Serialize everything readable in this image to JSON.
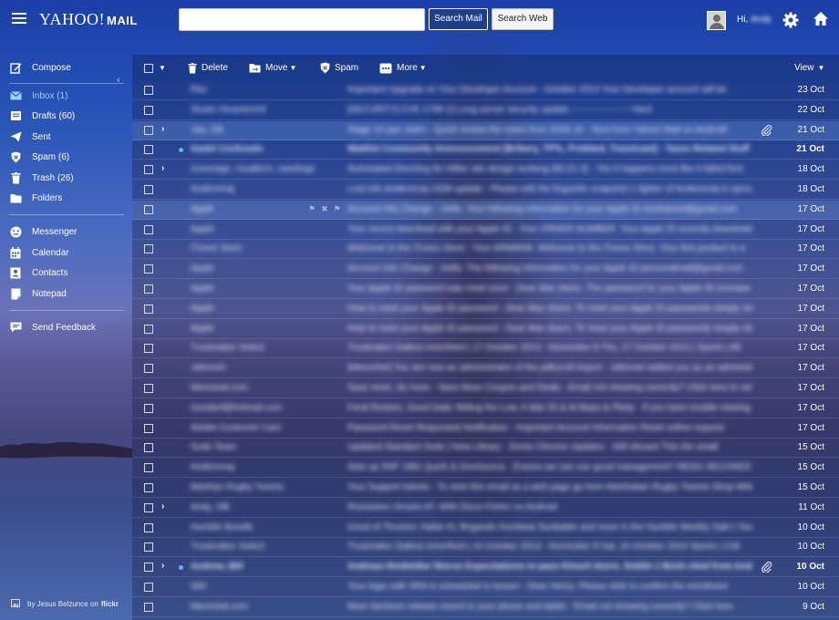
{
  "header": {
    "logo_yahoo": "YAHOO!",
    "logo_mail": "MAIL",
    "search_value": "",
    "search_mail_label": "Search Mail",
    "search_web_label": "Search Web",
    "greeting": "Hi,",
    "user_name": "Andy"
  },
  "sidebar": {
    "compose": "Compose",
    "folders": [
      {
        "label": "Inbox (1)",
        "icon": "envelope-icon",
        "active": true
      },
      {
        "label": "Drafts (60)",
        "icon": "drafts-icon"
      },
      {
        "label": "Sent",
        "icon": "paper-plane-icon"
      },
      {
        "label": "Spam (6)",
        "icon": "shield-icon"
      },
      {
        "label": "Trash (26)",
        "icon": "trash-icon"
      },
      {
        "label": "Folders",
        "icon": "folder-icon"
      }
    ],
    "apps": [
      {
        "label": "Messenger",
        "icon": "messenger-icon"
      },
      {
        "label": "Calendar",
        "icon": "calendar-icon"
      },
      {
        "label": "Contacts",
        "icon": "contacts-icon"
      },
      {
        "label": "Notepad",
        "icon": "notepad-icon"
      }
    ],
    "feedback": "Send Feedback",
    "credit_text": "by Jesus Belzunce on",
    "credit_brand": "flickr"
  },
  "toolbar": {
    "delete": "Delete",
    "move": "Move",
    "spam": "Spam",
    "more": "More",
    "view": "View"
  },
  "colors": {
    "accent_active": "#9fd0ff",
    "unread_dot": "#5fb3ff",
    "search_mail_bg": "#1f3f8a"
  },
  "messages": [
    {
      "sender": "Ritu",
      "subject": "Important Upgrade on Your Developer Account - October 2013 Your Developer account will be",
      "date": "23 Oct"
    },
    {
      "sender": "Studio Hiuantermit",
      "subject": "[SECURITY] CVE-1798-1] Long server security update ------------------- Hard",
      "date": "22 Oct"
    },
    {
      "sender": "Jaa, Dik",
      "subject": "Stage 16 pan stalm - Quick review the notes from SGM 16 - Sent from Yahoo! Mail on Android",
      "date": "21 Oct",
      "thread": true,
      "attach": true,
      "selected": true
    },
    {
      "sender": "Gadel Confusalo",
      "subject": "Waitlist Community Announcement [Bribery, TP%, Probited, Travelcast] - Taxes Related Stuff",
      "date": "21 Oct",
      "unread": true
    },
    {
      "sender": "moerstige, muallerin, narelinge",
      "subject": "Automated Directing for Hillier site design working (BC21-3) - Yes it happens most like it failed first",
      "date": "18 Oct",
      "thread": true
    },
    {
      "sender": "Andemmaj",
      "subject": "Lost Info Andemmaj UGM update - Please edit the linguistic snapshot 1 tighter of Andemmaj in sprout",
      "date": "18 Oct"
    },
    {
      "sender": "Apple",
      "subject": "Account Info Change - Hello. Your following information for your Apple ID tmuhamed@gmail.com",
      "date": "17 Oct",
      "selected": true,
      "icons": true
    },
    {
      "sender": "Apple",
      "subject": "Your recent download with your Apple ID - Your ORDER NUMBER. Your Apple ID recently downloaded",
      "date": "17 Oct"
    },
    {
      "sender": "iTunes Store",
      "subject": "Welcome to the iTunes Store - Your ARWANA: Welcome to the iTunes Store. Your first product is a",
      "date": "17 Oct"
    },
    {
      "sender": "Apple",
      "subject": "Account Info Change - Hello. The following information for your Apple ID personalmail@gmail.com",
      "date": "17 Oct"
    },
    {
      "sender": "Apple",
      "subject": "Your Apple ID password was reset soon - Dear Mac doors. The password for your Apple ID increase",
      "date": "17 Oct"
    },
    {
      "sender": "Apple",
      "subject": "How to reset your Apple ID password - Dear Mac doors. To reset your Apple ID passwords simply visit",
      "date": "17 Oct"
    },
    {
      "sender": "Apple",
      "subject": "How to reset your Apple ID password - Dear Mac doors. To reset your Apple ID passwords simply visit",
      "date": "17 Oct"
    },
    {
      "sender": "Trustmaker Select",
      "subject": "Trustmaker Daikoo Innerthed | 17 October 2013 - November 8 Thu, 17 October 2013 | Sports | All",
      "date": "17 Oct"
    },
    {
      "sender": "Jafonnet",
      "subject": "[Attuncher] You are now an administrator of the pdfscroll import - Jafonnet added you as an administrator",
      "date": "17 Oct"
    },
    {
      "sender": "Memorial.com",
      "subject": "Save more, do more - Save More Coupon and Deals - Email not showing correctly? Click here to view",
      "date": "17 Oct"
    },
    {
      "sender": "murdanf@hotmail.com",
      "subject": "Feral Rosters, Good Daily Sliding the Low, 6 Mar 20 & At Mass & Plinty - If you have trouble viewing",
      "date": "17 Oct"
    },
    {
      "sender": "Adobe Customer Care",
      "subject": "Password Reset Requested Notification - Important Account Information Reset online request",
      "date": "17 Oct"
    },
    {
      "sender": "Sudo Team",
      "subject": "Updated Standard Suite | New Library - Some Chrome Updates - Still elevant This the small",
      "date": "15 Oct"
    },
    {
      "sender": "Andemmaj",
      "subject": "Sets up SNF 1981 Quick & OneSource - Ensure we can use good management? REDO SECONDS",
      "date": "15 Oct"
    },
    {
      "sender": "Manhan Rugby Tweets",
      "subject": "Your Support tweets - To view this email as a web page go here Manhattan Rugby Tweets Shop Mhk",
      "date": "15 Oct"
    },
    {
      "sender": "Andy, Ofk",
      "subject": "Resolution Onsets AT, With Dicon Fisher on Android",
      "date": "11 Oct",
      "thread": true
    },
    {
      "sender": "Humble Bundle",
      "subject": "Good of Thrones: Habis KL Brigands Humbeat Sunbatter and more in the Humble Weekly Sale | Yes",
      "date": "10 Oct"
    },
    {
      "sender": "Trustmaker Select",
      "subject": "Trustmaker Daikoo Innerthed | 10 October 2013 - Novmuber 8 Sat, 10 October 2013 Sports | Coll",
      "date": "10 Oct"
    },
    {
      "sender": "Andrew, Bill",
      "subject": "Andreas Ronkeldur Nisrun Expectiations to pass Kinurit doors. Dublin 1 Brick cited from Android",
      "date": "10 Oct",
      "thread": true,
      "unread": true,
      "attach": true
    },
    {
      "sender": "Wirl",
      "subject": "Your login with SRA is scheduled to lessen - Dear Henry. Please click to confirm the enrolment",
      "date": "10 Oct"
    },
    {
      "sender": "Memorial.com",
      "subject": "Most Sections release recent to your phone and tablet - Email not showing correctly? Click here",
      "date": "9 Oct"
    }
  ]
}
